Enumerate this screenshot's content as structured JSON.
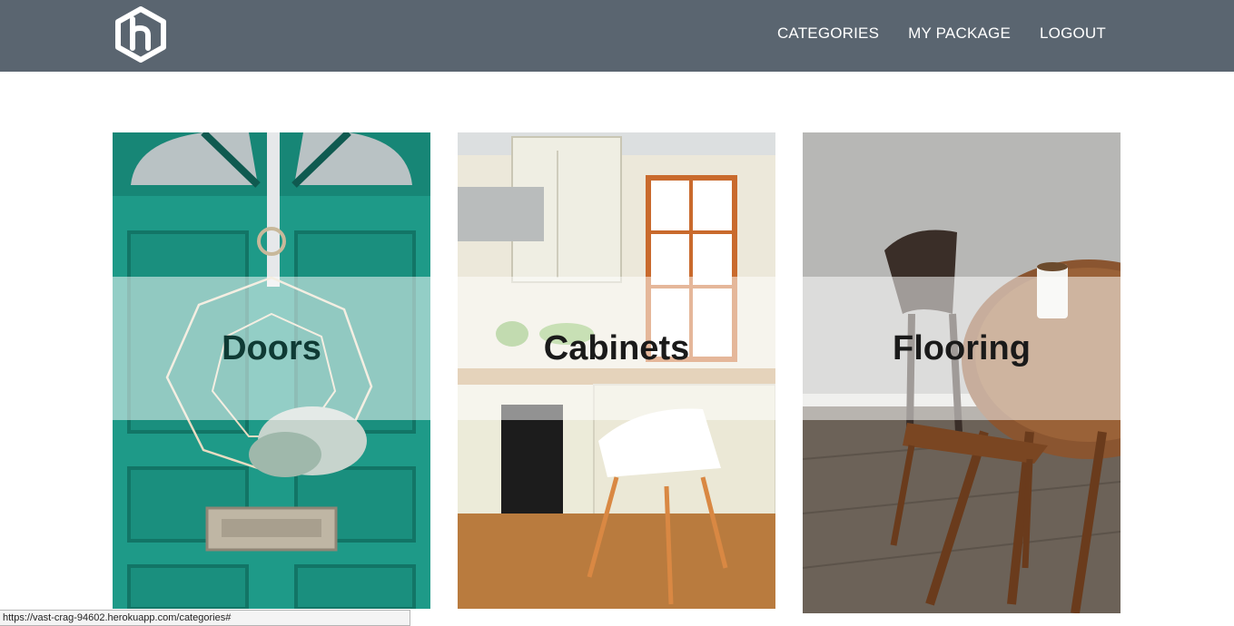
{
  "header": {
    "logo_icon": "hexagon-h-logo",
    "nav": [
      {
        "label": "CATEGORIES"
      },
      {
        "label": "MY PACKAGE"
      },
      {
        "label": "LOGOUT"
      }
    ]
  },
  "categories": [
    {
      "title": "Doors",
      "image": "teal front door with geometric wreath"
    },
    {
      "title": "Cabinets",
      "image": "cream kitchen cabinets with white chair"
    },
    {
      "title": "Flooring",
      "image": "wooden table and chair on wood floor"
    }
  ],
  "status_bar": {
    "url": "https://vast-crag-94602.herokuapp.com/categories#"
  },
  "colors": {
    "navbar": "#5a6570",
    "door_teal": "#1e9a88"
  }
}
